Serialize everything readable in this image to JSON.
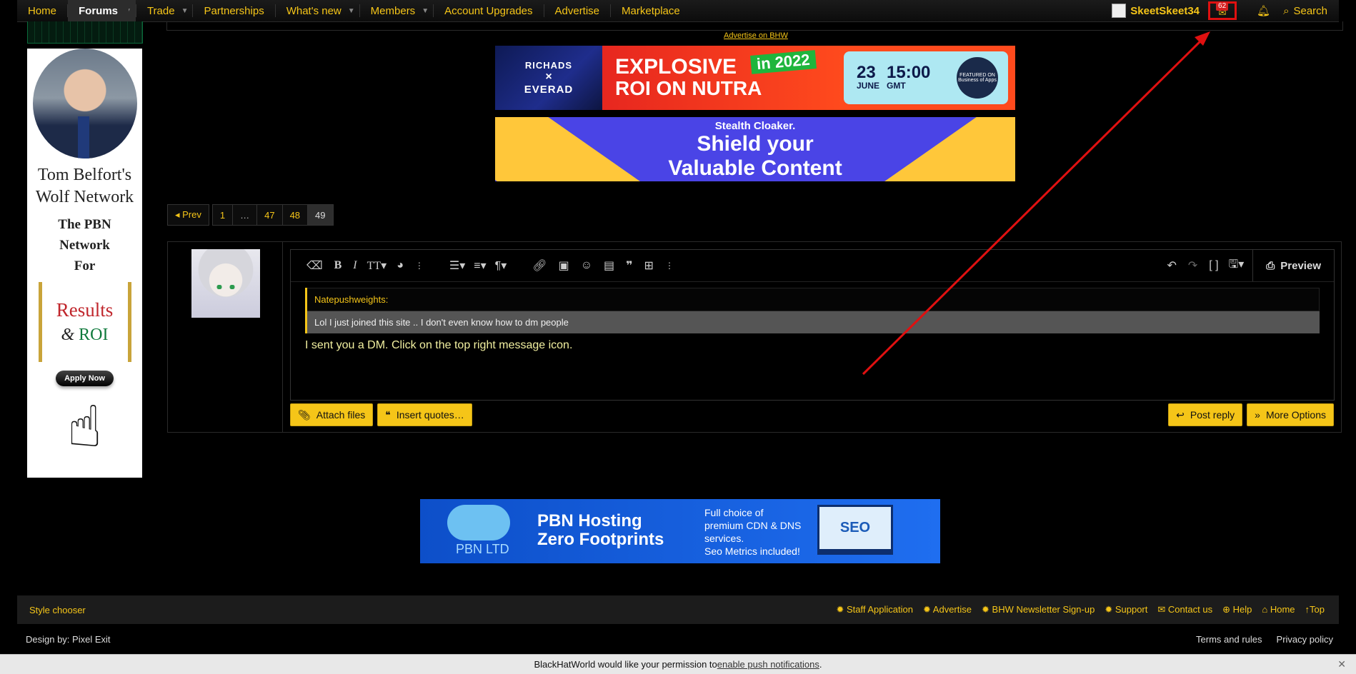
{
  "nav": {
    "items": [
      {
        "label": "Home",
        "caret": false
      },
      {
        "label": "Forums",
        "caret": true,
        "active": true
      },
      {
        "label": "Trade",
        "caret": true
      },
      {
        "label": "Partnerships",
        "caret": false
      },
      {
        "label": "What's new",
        "caret": true
      },
      {
        "label": "Members",
        "caret": true
      },
      {
        "label": "Account Upgrades",
        "caret": false
      },
      {
        "label": "Advertise",
        "caret": false
      },
      {
        "label": "Marketplace",
        "caret": false
      }
    ],
    "username": "SkeetSkeet34",
    "inbox_badge": "62",
    "search_label": "Search"
  },
  "sidebar_ad": {
    "name_line1": "Tom Belfort's",
    "name_line2": "Wolf Network",
    "sub_line1": "The PBN",
    "sub_line2": "Network",
    "sub_line3": "For",
    "results": "Results",
    "amp": "&",
    "roi": "ROI",
    "apply": "Apply Now"
  },
  "ad_label": "Advertise on BHW",
  "banner1": {
    "brand1": "RICHADS",
    "x": "×",
    "brand2": "EVERAD",
    "line1": "EXPLOSIVE",
    "line2": "ROI ON NUTRA",
    "pill": "in 2022",
    "day": "23",
    "month": "JUNE",
    "time": "15:00",
    "tz": "GMT",
    "seal": "FEATURED ON Business of Apps"
  },
  "banner2": {
    "line1": "Stealth Cloaker.",
    "line2": "Shield your",
    "line3": "Valuable Content"
  },
  "pagination": {
    "prev": "◂ Prev",
    "pages": [
      "1",
      "…",
      "47",
      "48",
      "49"
    ],
    "current": "49"
  },
  "editor": {
    "preview_label": "Preview",
    "quote_author": "Natepushweights:",
    "quote_text": "Lol I just joined this site .. I don't even know how to dm people",
    "text": "I sent you a DM. Click on the top right message icon."
  },
  "buttons": {
    "attach": "Attach files",
    "insert_quotes": "Insert quotes…",
    "post_reply": "Post reply",
    "more_options": "More Options"
  },
  "banner3": {
    "cloud_label": "PBN LTD",
    "title1": "PBN Hosting",
    "title2": "Zero Footprints",
    "desc1": "Full choice of",
    "desc2": "premium CDN & DNS",
    "desc3": "services.",
    "desc4": "Seo Metrics included!",
    "laptop": "SEO"
  },
  "footer": {
    "style_chooser": "Style chooser",
    "links": [
      {
        "icon": "✹",
        "label": "Staff Application"
      },
      {
        "icon": "✹",
        "label": "Advertise"
      },
      {
        "icon": "✹",
        "label": "BHW Newsletter Sign-up"
      },
      {
        "icon": "✹",
        "label": "Support"
      },
      {
        "icon": "✉",
        "label": "Contact us"
      },
      {
        "icon": "⊕",
        "label": "Help"
      },
      {
        "icon": "⌂",
        "label": "Home"
      },
      {
        "icon": "↑",
        "label": "Top"
      }
    ],
    "design": "Design by: Pixel Exit",
    "terms": "Terms and rules",
    "privacy": "Privacy policy"
  },
  "push": {
    "text_before": "BlackHatWorld would like your permission to ",
    "link": "enable push notifications",
    "text_after": "."
  },
  "colors": {
    "accent": "#f5c518",
    "annotation": "#e01010"
  }
}
